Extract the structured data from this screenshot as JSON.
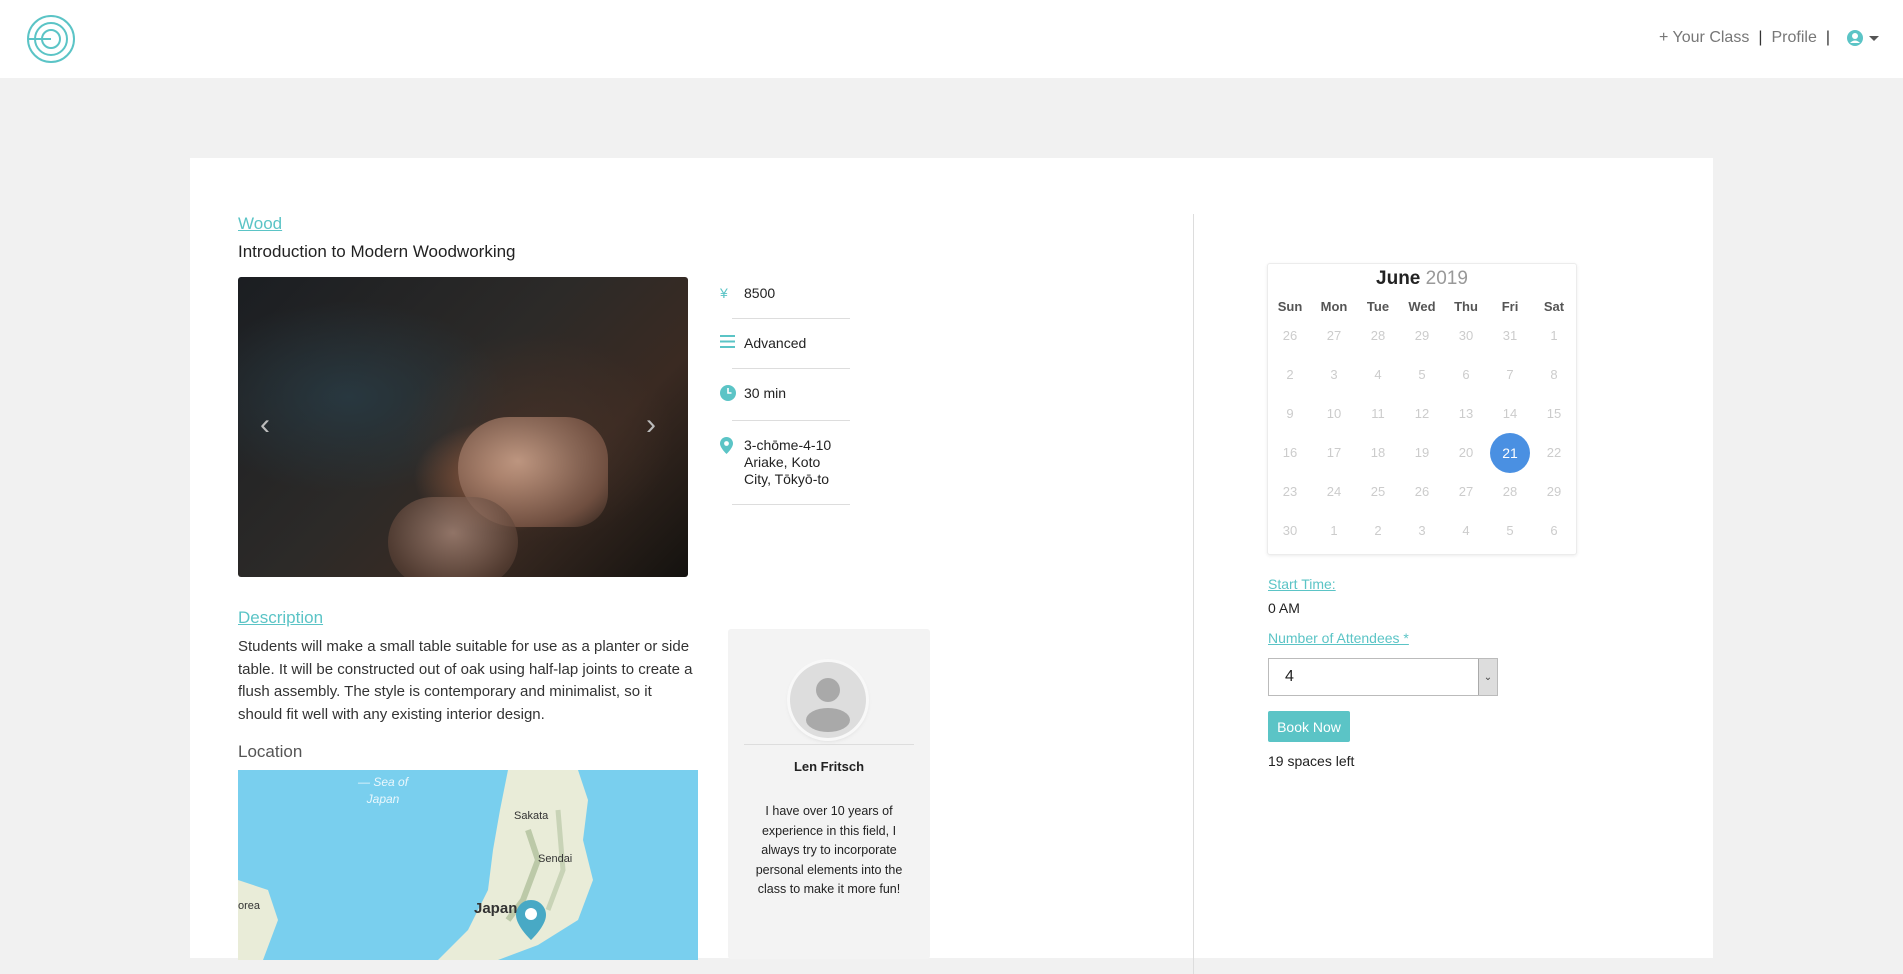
{
  "nav": {
    "add_class": "+ Your Class",
    "separator": "|",
    "profile": "Profile",
    "user_icon": "user-circle-icon"
  },
  "class": {
    "category": "Wood",
    "title": "Introduction to Modern Woodworking",
    "price": "8500",
    "level": "Advanced",
    "duration": "30 min",
    "address": "3-chōme-4-10 Ariake, Koto City, Tōkyō-to"
  },
  "description": {
    "heading": "Description",
    "text": "Students will make a small table suitable for use as a planter or side table. It will be constructed out of oak using half-lap joints to create a flush assembly. The style is contemporary and minimalist, so it should fit well with any existing interior design."
  },
  "location": {
    "heading": "Location",
    "map_labels": {
      "sea_line1": "— Sea of",
      "sea_line2": "Japan",
      "sakata": "Sakata",
      "sendai": "Sendai",
      "korea": "orea",
      "japan": "Japan"
    }
  },
  "instructor": {
    "name": "Len Fritsch",
    "bio": "I have over 10 years of experience in this field, I always try to incorporate personal elements into the class to make it more fun!"
  },
  "calendar": {
    "month": "June",
    "year": "2019",
    "weekdays": [
      "Sun",
      "Mon",
      "Tue",
      "Wed",
      "Thu",
      "Fri",
      "Sat"
    ],
    "weeks": [
      [
        "26",
        "27",
        "28",
        "29",
        "30",
        "31",
        "1"
      ],
      [
        "2",
        "3",
        "4",
        "5",
        "6",
        "7",
        "8"
      ],
      [
        "9",
        "10",
        "11",
        "12",
        "13",
        "14",
        "15"
      ],
      [
        "16",
        "17",
        "18",
        "19",
        "20",
        "21",
        "22"
      ],
      [
        "23",
        "24",
        "25",
        "26",
        "27",
        "28",
        "29"
      ],
      [
        "30",
        "1",
        "2",
        "3",
        "4",
        "5",
        "6"
      ]
    ],
    "selected": "21",
    "selected_color": "#4a90e2"
  },
  "booking": {
    "start_label": "Start Time:",
    "start_value": "0 AM",
    "attendees_label": "Number of Attendees *",
    "attendees_value": "4",
    "book_label": "Book Now",
    "spaces_left": "19 spaces left"
  },
  "colors": {
    "accent": "#5bc4c6",
    "background": "#f1f1f1"
  }
}
